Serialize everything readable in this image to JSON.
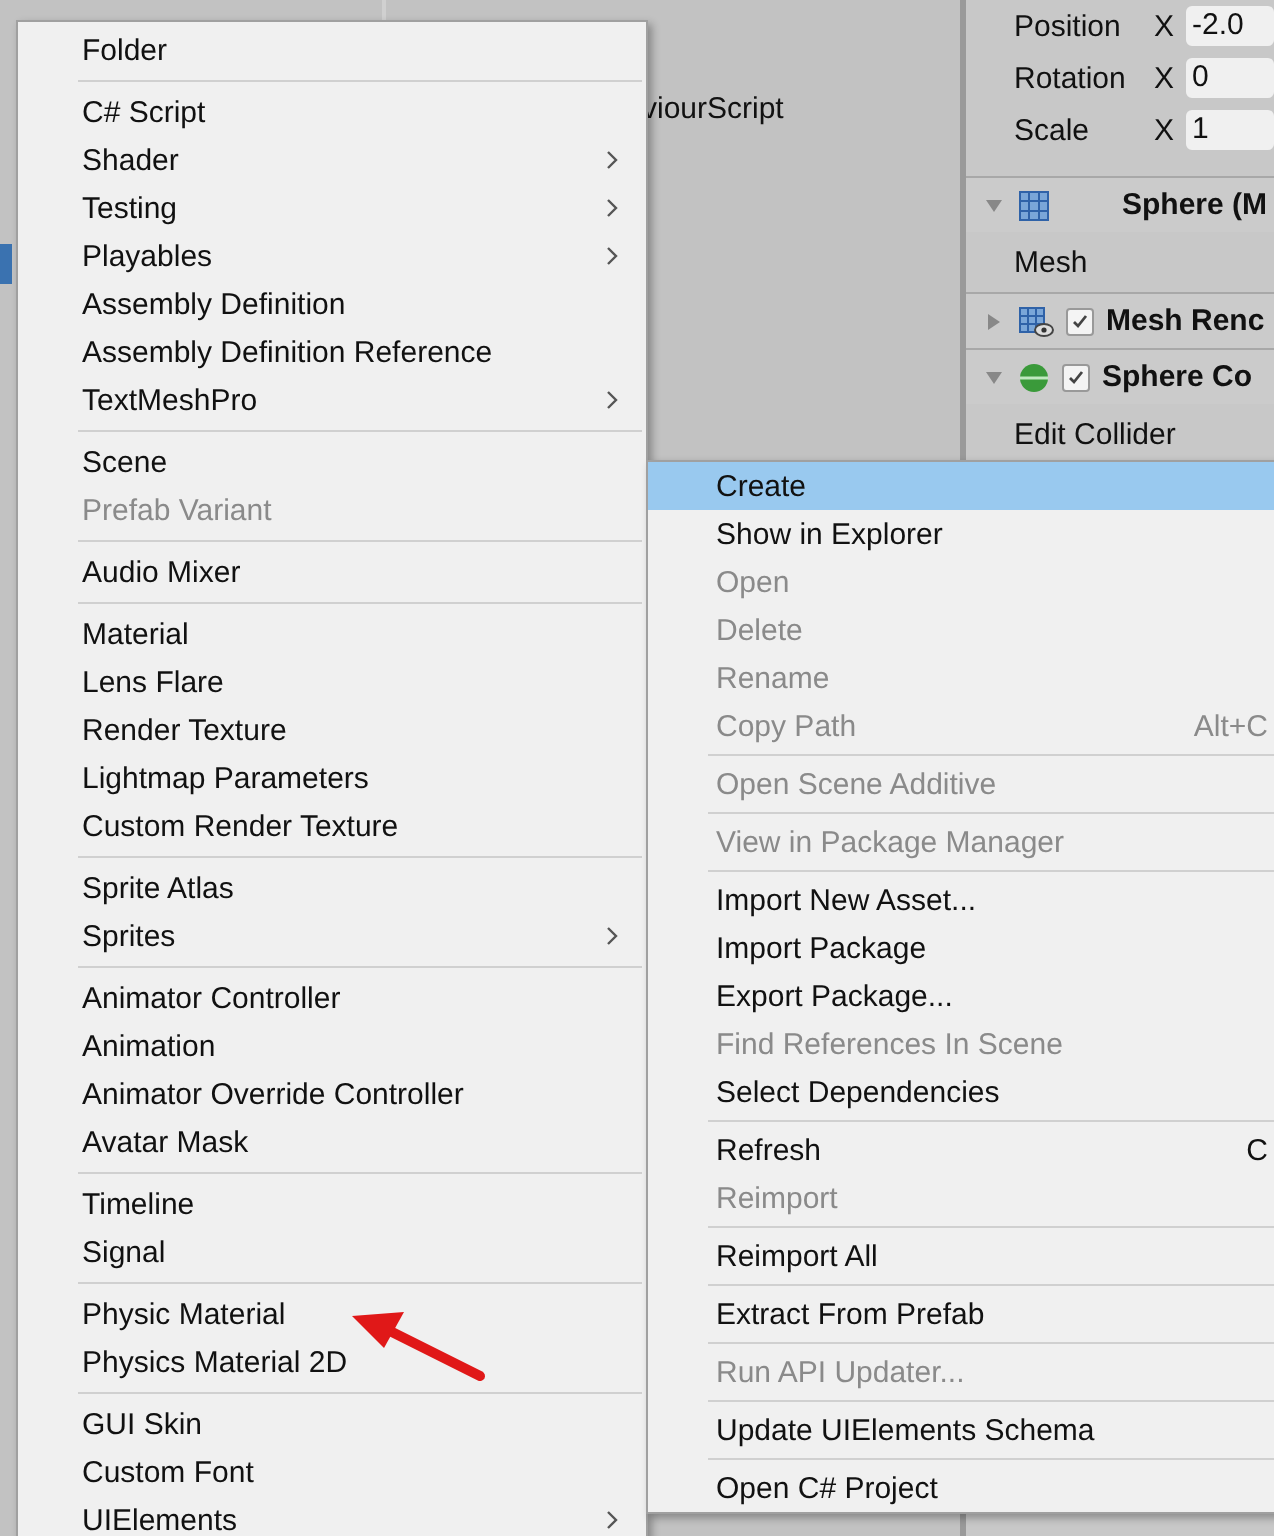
{
  "project_panel": {
    "items": [
      {
        "label": "viourScript"
      }
    ]
  },
  "inspector": {
    "transform_rows": [
      {
        "label": "Position",
        "axis": "X",
        "value": "-2.0"
      },
      {
        "label": "Rotation",
        "axis": "X",
        "value": "0"
      },
      {
        "label": "Scale",
        "axis": "X",
        "value": "1"
      }
    ],
    "components": [
      {
        "kind": "mesh-filter",
        "title": "Sphere (M",
        "expanded": true,
        "fields": [
          "Mesh"
        ]
      },
      {
        "kind": "mesh-renderer",
        "title": "Mesh Renc",
        "expanded": false,
        "enabled": true
      },
      {
        "kind": "collider",
        "title": "Sphere Co",
        "expanded": true,
        "enabled": true,
        "fields": [
          "Edit Collider"
        ]
      }
    ]
  },
  "create_submenu": {
    "items": [
      {
        "kind": "item",
        "label": "Folder"
      },
      {
        "kind": "separator"
      },
      {
        "kind": "item",
        "label": "C# Script"
      },
      {
        "kind": "item",
        "label": "Shader",
        "submenu": true
      },
      {
        "kind": "item",
        "label": "Testing",
        "submenu": true
      },
      {
        "kind": "item",
        "label": "Playables",
        "submenu": true
      },
      {
        "kind": "item",
        "label": "Assembly Definition"
      },
      {
        "kind": "item",
        "label": "Assembly Definition Reference"
      },
      {
        "kind": "item",
        "label": "TextMeshPro",
        "submenu": true
      },
      {
        "kind": "separator"
      },
      {
        "kind": "item",
        "label": "Scene"
      },
      {
        "kind": "item",
        "label": "Prefab Variant",
        "disabled": true
      },
      {
        "kind": "separator"
      },
      {
        "kind": "item",
        "label": "Audio Mixer"
      },
      {
        "kind": "separator"
      },
      {
        "kind": "item",
        "label": "Material"
      },
      {
        "kind": "item",
        "label": "Lens Flare"
      },
      {
        "kind": "item",
        "label": "Render Texture"
      },
      {
        "kind": "item",
        "label": "Lightmap Parameters"
      },
      {
        "kind": "item",
        "label": "Custom Render Texture"
      },
      {
        "kind": "separator"
      },
      {
        "kind": "item",
        "label": "Sprite Atlas"
      },
      {
        "kind": "item",
        "label": "Sprites",
        "submenu": true
      },
      {
        "kind": "separator"
      },
      {
        "kind": "item",
        "label": "Animator Controller"
      },
      {
        "kind": "item",
        "label": "Animation"
      },
      {
        "kind": "item",
        "label": "Animator Override Controller"
      },
      {
        "kind": "item",
        "label": "Avatar Mask"
      },
      {
        "kind": "separator"
      },
      {
        "kind": "item",
        "label": "Timeline"
      },
      {
        "kind": "item",
        "label": "Signal"
      },
      {
        "kind": "separator"
      },
      {
        "kind": "item",
        "label": "Physic Material"
      },
      {
        "kind": "item",
        "label": "Physics Material 2D"
      },
      {
        "kind": "separator"
      },
      {
        "kind": "item",
        "label": "GUI Skin"
      },
      {
        "kind": "item",
        "label": "Custom Font"
      },
      {
        "kind": "item",
        "label": "UIElements",
        "submenu": true
      }
    ]
  },
  "context_menu": {
    "items": [
      {
        "kind": "item",
        "label": "Create",
        "selected": true
      },
      {
        "kind": "item",
        "label": "Show in Explorer",
        "selected": false
      },
      {
        "kind": "item",
        "label": "Open",
        "disabled": true,
        "selected": false
      },
      {
        "kind": "item",
        "label": "Delete",
        "disabled": true,
        "selected": false
      },
      {
        "kind": "item",
        "label": "Rename",
        "disabled": true,
        "selected": false
      },
      {
        "kind": "item",
        "label": "Copy Path",
        "disabled": true,
        "shortcut": "Alt+C",
        "selected": false
      },
      {
        "kind": "separator"
      },
      {
        "kind": "item",
        "label": "Open Scene Additive",
        "disabled": true,
        "selected": false
      },
      {
        "kind": "separator"
      },
      {
        "kind": "item",
        "label": "View in Package Manager",
        "disabled": true,
        "selected": false
      },
      {
        "kind": "separator"
      },
      {
        "kind": "item",
        "label": "Import New Asset...",
        "selected": false
      },
      {
        "kind": "item",
        "label": "Import Package",
        "selected": false
      },
      {
        "kind": "item",
        "label": "Export Package...",
        "selected": false
      },
      {
        "kind": "item",
        "label": "Find References In Scene",
        "disabled": true,
        "selected": false
      },
      {
        "kind": "item",
        "label": "Select Dependencies",
        "selected": false
      },
      {
        "kind": "separator"
      },
      {
        "kind": "item",
        "label": "Refresh",
        "shortcut": "C",
        "selected": false
      },
      {
        "kind": "item",
        "label": "Reimport",
        "disabled": true,
        "selected": false
      },
      {
        "kind": "separator"
      },
      {
        "kind": "item",
        "label": "Reimport All",
        "selected": false
      },
      {
        "kind": "separator"
      },
      {
        "kind": "item",
        "label": "Extract From Prefab",
        "selected": false
      },
      {
        "kind": "separator"
      },
      {
        "kind": "item",
        "label": "Run API Updater...",
        "disabled": true,
        "selected": false
      },
      {
        "kind": "separator"
      },
      {
        "kind": "item",
        "label": "Update UIElements Schema",
        "selected": false
      },
      {
        "kind": "separator"
      },
      {
        "kind": "item",
        "label": "Open C# Project",
        "selected": false
      }
    ]
  }
}
